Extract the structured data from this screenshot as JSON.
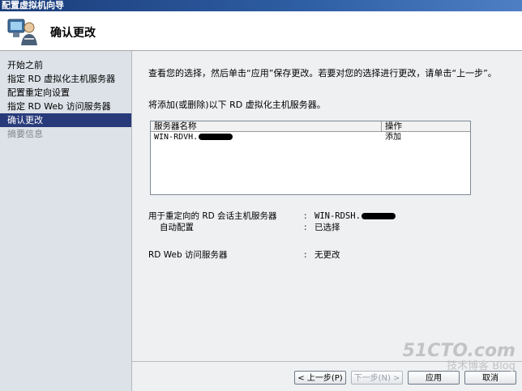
{
  "window": {
    "title": "配置虚拟机向导"
  },
  "header": {
    "title": "确认更改",
    "icon": "wizard-computer-user-icon"
  },
  "sidebar": {
    "steps": [
      {
        "label": "开始之前",
        "state": "normal"
      },
      {
        "label": "指定 RD 虚拟化主机服务器",
        "state": "normal"
      },
      {
        "label": "配置重定向设置",
        "state": "normal"
      },
      {
        "label": "指定 RD Web 访问服务器",
        "state": "normal"
      },
      {
        "label": "确认更改",
        "state": "active"
      },
      {
        "label": "摘要信息",
        "state": "disabled"
      }
    ]
  },
  "main": {
    "intro": "查看您的选择，然后单击“应用”保存更改。若要对您的选择进行更改，请单击“上一步”。",
    "add_line": "将添加(或删除)以下 RD 虚拟化主机服务器。",
    "table": {
      "headers": [
        "服务器名称",
        "操作"
      ],
      "rows": [
        {
          "name": "WIN-RDVH.",
          "action": "添加"
        }
      ]
    },
    "redirect": {
      "label": "用于重定向的 RD 会话主机服务器",
      "colon": ":",
      "value": "WIN-RDSH.",
      "auto_label": "自动配置",
      "auto_value": "已选择"
    },
    "web": {
      "label": "RD Web 访问服务器",
      "colon": ":",
      "value": "无更改"
    }
  },
  "buttons": {
    "prev": "< 上一步(P)",
    "next": "下一步(N) >",
    "apply": "应用",
    "cancel": "取消"
  },
  "watermark": {
    "line1": "51CTO.com",
    "line2": "技术博客 Blog"
  }
}
